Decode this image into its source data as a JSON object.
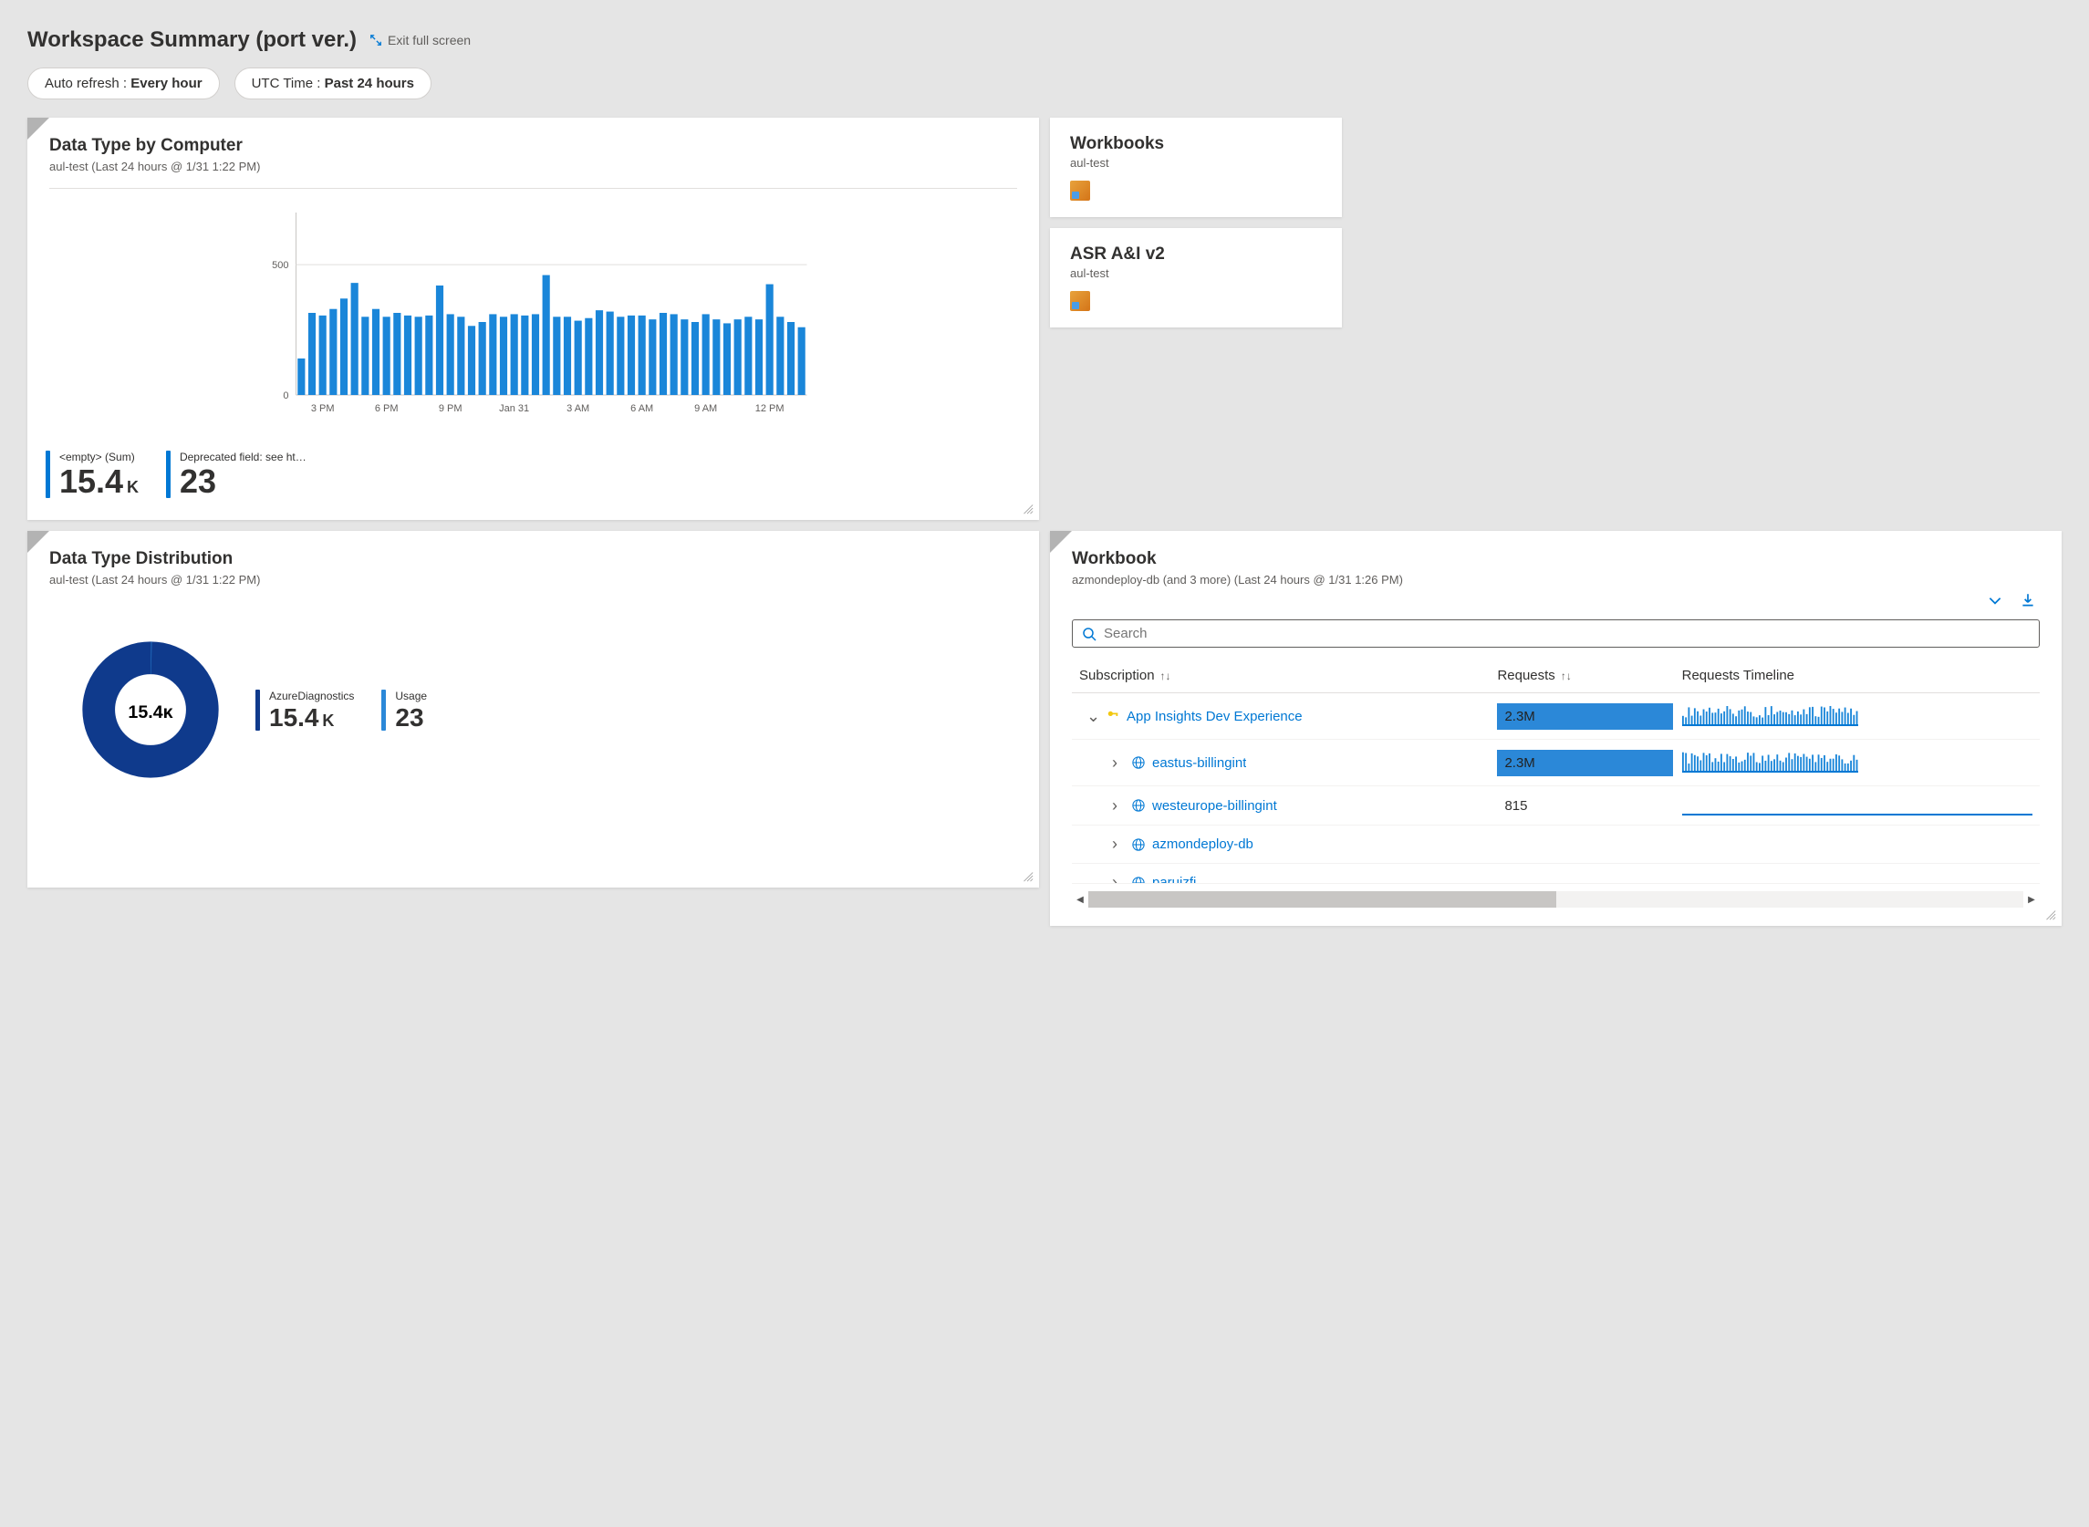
{
  "header": {
    "title": "Workspace Summary (port ver.)",
    "exit_label": "Exit full screen"
  },
  "pills": {
    "auto_refresh_label": "Auto refresh : ",
    "auto_refresh_value": "Every hour",
    "time_label": "UTC Time : ",
    "time_value": "Past 24 hours"
  },
  "tile1": {
    "title": "Data Type by Computer",
    "subtitle": "aul-test (Last 24 hours @ 1/31 1:22 PM)",
    "y_ticks": [
      "500",
      "0"
    ],
    "x_ticks": [
      "3 PM",
      "6 PM",
      "9 PM",
      "Jan 31",
      "3 AM",
      "6 AM",
      "9 AM",
      "12 PM"
    ],
    "stats": [
      {
        "label": "<empty> (Sum)",
        "value": "15.4",
        "unit": "K"
      },
      {
        "label": "Deprecated field: see http:…",
        "value": "23",
        "unit": ""
      }
    ]
  },
  "chart_data": {
    "type": "bar",
    "title": "Data Type by Computer",
    "xlabel": "",
    "ylabel": "",
    "ylim": [
      0,
      700
    ],
    "x_tick_labels": [
      "3 PM",
      "6 PM",
      "9 PM",
      "Jan 31",
      "3 AM",
      "6 AM",
      "9 AM",
      "12 PM"
    ],
    "values": [
      140,
      315,
      305,
      330,
      370,
      430,
      300,
      330,
      300,
      315,
      305,
      300,
      305,
      420,
      310,
      300,
      265,
      280,
      310,
      300,
      310,
      305,
      310,
      460,
      300,
      300,
      285,
      295,
      325,
      320,
      300,
      305,
      305,
      290,
      315,
      310,
      290,
      280,
      310,
      290,
      275,
      290,
      300,
      290,
      425,
      300,
      280,
      260
    ]
  },
  "right_tiles": [
    {
      "title": "Workbooks",
      "subtitle": "aul-test"
    },
    {
      "title": "ASR A&I v2",
      "subtitle": "aul-test"
    }
  ],
  "tile2": {
    "title": "Data Type Distribution",
    "subtitle": "aul-test (Last 24 hours @ 1/31 1:22 PM)",
    "donut_center": "15.4ᴋ",
    "legend": [
      {
        "label": "AzureDiagnostics",
        "value": "15.4",
        "unit": "K"
      },
      {
        "label": "Usage",
        "value": "23",
        "unit": ""
      }
    ]
  },
  "workbook": {
    "title": "Workbook",
    "subtitle": "azmondeploy-db (and 3 more) (Last 24 hours @ 1/31 1:26 PM)",
    "search_placeholder": "Search",
    "columns": {
      "c1": "Subscription",
      "c2": "Requests",
      "c3": "Requests Timeline"
    },
    "rows": [
      {
        "chevron": "down",
        "icon": "key",
        "name": "App Insights Dev Experience",
        "requests": "2.3M",
        "bar_full": true,
        "spark": true,
        "indent": 0
      },
      {
        "chevron": "right",
        "icon": "globe",
        "name": "eastus-billingint",
        "requests": "2.3M",
        "bar_full": true,
        "spark": true,
        "indent": 1
      },
      {
        "chevron": "right",
        "icon": "globe",
        "name": "westeurope-billingint",
        "requests": "815",
        "bar_full": false,
        "spark": false,
        "indent": 1
      },
      {
        "chevron": "right",
        "icon": "globe",
        "name": "azmondeploy-db",
        "requests": "",
        "bar_full": false,
        "spark": false,
        "indent": 1
      },
      {
        "chevron": "right",
        "icon": "globe",
        "name": "paruizfi",
        "requests": "",
        "bar_full": false,
        "spark": false,
        "indent": 1,
        "clipped": true
      }
    ]
  }
}
